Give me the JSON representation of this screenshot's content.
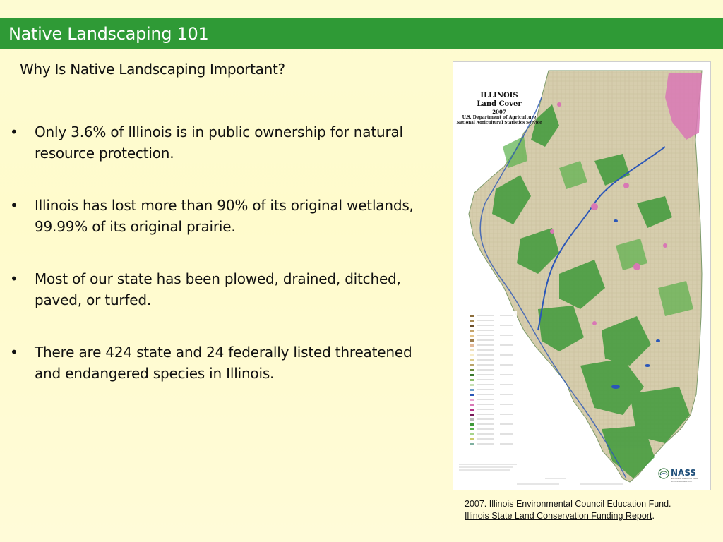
{
  "slide": {
    "title": "Native Landscaping 101",
    "subtitle": "Why Is Native Landscaping Important?",
    "bullet_char": "•",
    "bullets": [
      "Only 3.6% of Illinois is in public ownership for natural resource protection.",
      "Illinois has lost more than 90% of its original wetlands, 99.99% of its original prairie.",
      "Most of our state has been plowed, drained, ditched, paved, or turfed.",
      "There are 424 state and 24 federally listed threatened and endangered species in Illinois."
    ]
  },
  "map": {
    "title_line1": "ILLINOIS",
    "title_line2": "Land Cover",
    "year": "2007",
    "agency": "U.S. Department of Agriculture",
    "service": "National Agricultural Statistics Service",
    "logo_text": "NASS",
    "logo_subtext": "NATIONAL AGRICULTURAL STATISTICS SERVICE"
  },
  "caption": {
    "text": "2007. Illinois Environmental Council Education Fund. ",
    "link": "Illinois State Land Conservation Funding Report",
    "end": "."
  },
  "colors": {
    "title_bar": "#2f9a36",
    "background": "#fffbcc",
    "map_farmland": "#d8cfae",
    "map_forest": "#3f9a3a",
    "map_urban": "#d977b5",
    "map_water": "#2a56b8"
  }
}
